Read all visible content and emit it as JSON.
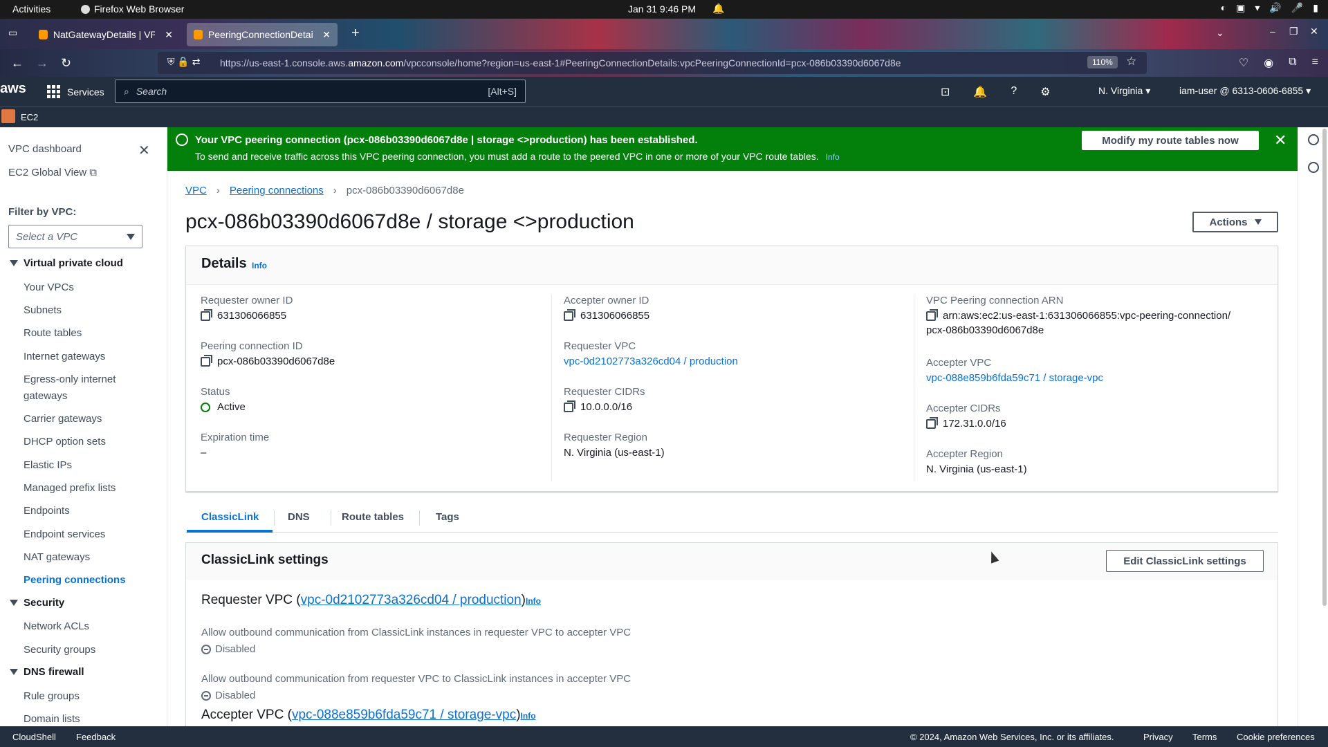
{
  "os": {
    "activities": "Activities",
    "app_name": "Firefox Web Browser",
    "clock": "Jan 31  9:46 PM"
  },
  "browser": {
    "tabs": [
      {
        "label": "NatGatewayDetails | VPC",
        "active": false
      },
      {
        "label": "PeeringConnectionDetail",
        "active": true
      }
    ],
    "url_prefix": "https://us-east-1.console.aws.",
    "url_domain": "amazon.com",
    "url_rest": "/vpcconsole/home?region=us-east-1#PeeringConnectionDetails:vpcPeeringConnectionId=pcx-086b03390d6067d8e",
    "zoom": "110%"
  },
  "aws_header": {
    "logo": "aws",
    "services": "Services",
    "search_placeholder": "Search",
    "search_shortcut": "[Alt+S]",
    "region": "N. Virginia",
    "user": "iam-user @ 6313-0606-6855",
    "service_badge": "EC2"
  },
  "sidebar": {
    "dashboard": "VPC dashboard",
    "global_view": "EC2 Global View",
    "filter_label": "Filter by VPC:",
    "filter_placeholder": "Select a VPC",
    "sections": [
      {
        "title": "Virtual private cloud",
        "items": [
          "Your VPCs",
          "Subnets",
          "Route tables",
          "Internet gateways",
          "Egress-only internet",
          "gateways",
          "Carrier gateways",
          "DHCP option sets",
          "Elastic IPs",
          "Managed prefix lists",
          "Endpoints",
          "Endpoint services",
          "NAT gateways",
          "Peering connections"
        ]
      },
      {
        "title": "Security",
        "items": [
          "Network ACLs",
          "Security groups"
        ]
      },
      {
        "title": "DNS firewall",
        "items": [
          "Rule groups",
          "Domain lists"
        ]
      }
    ],
    "active_item": "Peering connections"
  },
  "flash": {
    "title": "Your VPC peering connection (pcx-086b03390d6067d8e | storage <>production) has been established.",
    "description": "To send and receive traffic across this VPC peering connection, you must add a route to the peered VPC in one or more of your VPC route tables.",
    "info": "Info",
    "button": "Modify my route tables now",
    "color": "#037f0c"
  },
  "breadcrumb": [
    "VPC",
    "Peering connections",
    "pcx-086b03390d6067d8e"
  ],
  "page_title": "pcx-086b03390d6067d8e / storage <>production",
  "actions_label": "Actions",
  "details": {
    "heading": "Details",
    "info": "Info",
    "requester_owner_id": {
      "label": "Requester owner ID",
      "value": "631306066855"
    },
    "peering_connection_id": {
      "label": "Peering connection ID",
      "value": "pcx-086b03390d6067d8e"
    },
    "status": {
      "label": "Status",
      "value": "Active"
    },
    "expiration_time": {
      "label": "Expiration time",
      "value": "–"
    },
    "accepter_owner_id": {
      "label": "Accepter owner ID",
      "value": "631306066855"
    },
    "requester_vpc": {
      "label": "Requester VPC",
      "value": "vpc-0d2102773a326cd04 / production"
    },
    "requester_cidrs": {
      "label": "Requester CIDRs",
      "value": "10.0.0.0/16"
    },
    "requester_region": {
      "label": "Requester Region",
      "value": "N. Virginia (us-east-1)"
    },
    "arn": {
      "label": "VPC Peering connection ARN",
      "value_line1": "arn:aws:ec2:us-east-1:631306066855:vpc-peering-connection/",
      "value_line2": "pcx-086b03390d6067d8e"
    },
    "accepter_vpc": {
      "label": "Accepter VPC",
      "value": "vpc-088e859b6fda59c71 / storage-vpc"
    },
    "accepter_cidrs": {
      "label": "Accepter CIDRs",
      "value": "172.31.0.0/16"
    },
    "accepter_region": {
      "label": "Accepter Region",
      "value": "N. Virginia (us-east-1)"
    }
  },
  "tabs": [
    "ClassicLink",
    "DNS",
    "Route tables",
    "Tags"
  ],
  "classiclink": {
    "heading": "ClassicLink settings",
    "edit_button": "Edit ClassicLink settings",
    "requester_prefix": "Requester VPC (",
    "requester_link": "vpc-0d2102773a326cd04 / production",
    "accepter_prefix": "Accepter VPC (",
    "accepter_link": "vpc-088e859b6fda59c71 / storage-vpc",
    "suffix": ")",
    "info": "Info",
    "desc1": "Allow outbound communication from ClassicLink instances in requester VPC to accepter VPC",
    "desc2": "Allow outbound communication from requester VPC to ClassicLink instances in accepter VPC",
    "status1": "Disabled",
    "status2": "Disabled"
  },
  "footer": {
    "cloudshell": "CloudShell",
    "feedback": "Feedback",
    "copyright": "© 2024, Amazon Web Services, Inc. or its affiliates.",
    "privacy": "Privacy",
    "terms": "Terms",
    "cookies": "Cookie preferences"
  }
}
